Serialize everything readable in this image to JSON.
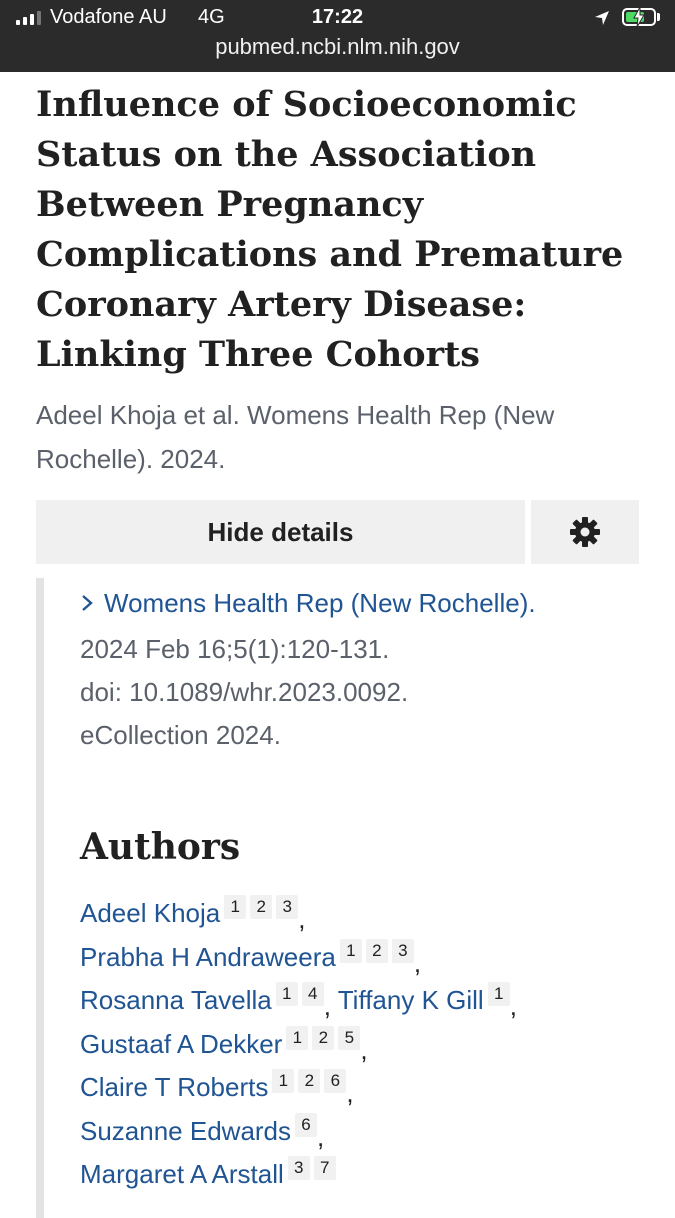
{
  "status_bar": {
    "carrier": "Vodafone AU",
    "network": "4G",
    "time": "17:22",
    "url": "pubmed.ncbi.nlm.nih.gov"
  },
  "article": {
    "title": "Influence of Socioeconomic Status on the Association Between Pregnancy Complications and Premature Coronary Artery Disease: Linking Three Cohorts",
    "citation_short": "Adeel Khoja et al. Womens Health Rep (New Rochelle). 2024."
  },
  "actions": {
    "hide_details_label": "Hide details",
    "settings_icon": "gear-icon"
  },
  "details": {
    "journal_link": "Womens Health Rep (New Rochelle).",
    "pub_date": "2024 Feb 16;5(1):120-131.",
    "doi": "doi: 10.1089/whr.2023.0092.",
    "ecollection": "eCollection 2024."
  },
  "authors_heading": "Authors",
  "authors": [
    {
      "name": "Adeel Khoja",
      "affiliations": [
        "1",
        "2",
        "3"
      ]
    },
    {
      "name": "Prabha H Andraweera",
      "affiliations": [
        "1",
        "2",
        "3"
      ]
    },
    {
      "name": "Rosanna Tavella",
      "affiliations": [
        "1",
        "4"
      ]
    },
    {
      "name": "Tiffany K Gill",
      "affiliations": [
        "1"
      ]
    },
    {
      "name": "Gustaaf A Dekker",
      "affiliations": [
        "1",
        "2",
        "5"
      ]
    },
    {
      "name": "Claire T Roberts",
      "affiliations": [
        "1",
        "2",
        "6"
      ]
    },
    {
      "name": "Suzanne Edwards",
      "affiliations": [
        "6"
      ]
    },
    {
      "name": "Margaret A Arstall",
      "affiliations": [
        "3",
        "7"
      ]
    }
  ],
  "colors": {
    "link": "#205493",
    "muted_text": "#5b616b",
    "button_bg": "#f0f0f0",
    "status_bar_bg": "#2b2b2b",
    "battery_fill": "#4cd964"
  }
}
